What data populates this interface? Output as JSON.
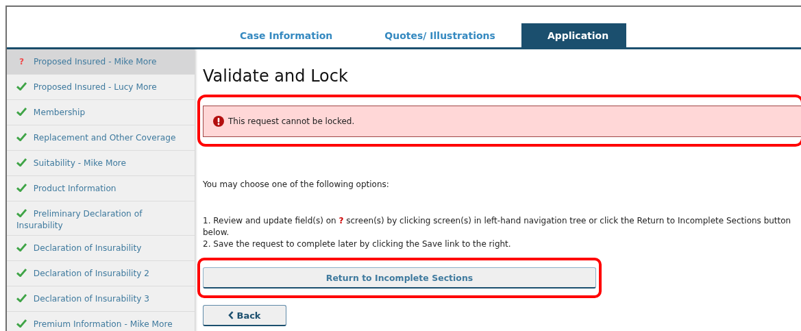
{
  "tabs": [
    {
      "label": "Case Information",
      "selected": false
    },
    {
      "label": "Quotes/ Illustrations",
      "selected": false
    },
    {
      "label": "Application",
      "selected": true
    }
  ],
  "sidebar": {
    "items": [
      {
        "label": "Proposed Insured - Mike More",
        "kind": "incomplete",
        "status_mark": "?",
        "selected": true
      },
      {
        "label": "Proposed Insured - Lucy More",
        "kind": "complete",
        "selected": false
      },
      {
        "label": "Membership",
        "kind": "complete",
        "selected": false
      },
      {
        "label": "Replacement and Other Coverage",
        "kind": "complete",
        "selected": false
      },
      {
        "label": "Suitability - Mike More",
        "kind": "complete",
        "selected": false
      },
      {
        "label": "Product Information",
        "kind": "complete",
        "selected": false
      },
      {
        "label": "Preliminary Declaration of Insurability",
        "kind": "complete",
        "selected": false
      },
      {
        "label": "Declaration of Insurability",
        "kind": "complete",
        "selected": false
      },
      {
        "label": "Declaration of Insurability 2",
        "kind": "complete",
        "selected": false
      },
      {
        "label": "Declaration of Insurability 3",
        "kind": "complete",
        "selected": false
      },
      {
        "label": "Premium Information - Mike More",
        "kind": "complete",
        "selected": false
      }
    ]
  },
  "page": {
    "title": "Validate and Lock",
    "alert": {
      "message": "This request cannot be locked.",
      "highlighted": true
    },
    "intro": "You may choose one of the following options:",
    "options": [
      {
        "before": "1. Review and update field(s) on",
        "mark": "?",
        "after": "screen(s) by clicking screen(s) in left-hand navigation tree or click the Return to Incomplete Sections button below."
      },
      {
        "before": "2. Save the request to complete later by clicking the Save link to the right."
      }
    ],
    "return_button": {
      "label": "Return to Incomplete Sections",
      "highlighted": true
    },
    "back_button": {
      "label": "Back"
    }
  }
}
